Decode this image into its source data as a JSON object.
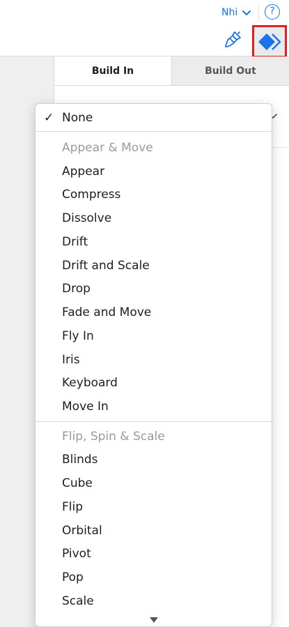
{
  "header": {
    "user_name": "Nhi",
    "help_label": "?"
  },
  "tabs": [
    {
      "label": "Build In",
      "active": true
    },
    {
      "label": "Build Out",
      "active": false
    }
  ],
  "menu": {
    "selected": "None",
    "check_mark": "✓",
    "groups": [
      {
        "header": "Appear & Move",
        "items": [
          "Appear",
          "Compress",
          "Dissolve",
          "Drift",
          "Drift and Scale",
          "Drop",
          "Fade and Move",
          "Fly In",
          "Iris",
          "Keyboard",
          "Move In"
        ]
      },
      {
        "header": "Flip, Spin & Scale",
        "items": [
          "Blinds",
          "Cube",
          "Flip",
          "Orbital",
          "Pivot",
          "Pop",
          "Scale"
        ]
      }
    ]
  },
  "icons": {
    "format": "paintbrush-icon",
    "animate": "animate-diamonds-icon",
    "user_menu": "chevron-down-icon",
    "scroll": "scroll-down-arrow-icon"
  },
  "colors": {
    "accent": "#1a73e8",
    "highlight_border": "#e02020",
    "header_text": "#9a9a9a"
  }
}
